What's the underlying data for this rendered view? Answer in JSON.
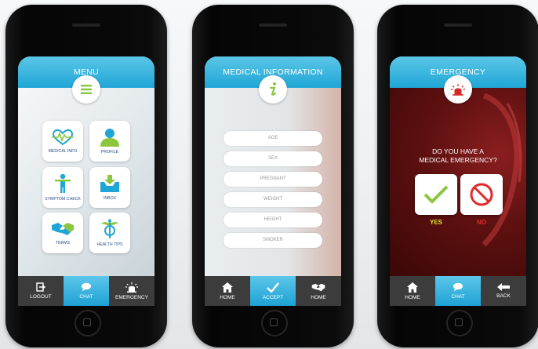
{
  "phones": {
    "menu": {
      "title": "MENU",
      "tiles": [
        {
          "label": "MEDICAL INFO",
          "icon": "heart-pulse-icon"
        },
        {
          "label": "PROFILE",
          "icon": "person-icon"
        },
        {
          "label": "SYMPTOM CHECK",
          "icon": "body-check-icon"
        },
        {
          "label": "INBOX",
          "icon": "inbox-icon"
        },
        {
          "label": "TERMS",
          "icon": "handshake-icon"
        },
        {
          "label": "HEALTH TIPS",
          "icon": "caduceus-icon"
        }
      ],
      "tabs": [
        {
          "label": "LOGOUT",
          "icon": "logout-icon",
          "active": false
        },
        {
          "label": "CHAT",
          "icon": "chat-icon",
          "active": true
        },
        {
          "label": "EMERGENCY",
          "icon": "siren-icon",
          "active": false
        }
      ]
    },
    "medical": {
      "title": "MEDICAL INFORMATION",
      "fields": [
        {
          "placeholder": "AGE"
        },
        {
          "placeholder": "SEX"
        },
        {
          "placeholder": "PREGNANT"
        },
        {
          "placeholder": "WEIGHT"
        },
        {
          "placeholder": "HEIGHT"
        },
        {
          "placeholder": "SMOKER"
        }
      ],
      "tabs": [
        {
          "label": "HOME",
          "icon": "home-icon",
          "active": false
        },
        {
          "label": "ACCEPT",
          "icon": "check-icon",
          "active": true
        },
        {
          "label": "HOME",
          "icon": "handshake-icon",
          "active": false
        }
      ]
    },
    "emergency": {
      "title": "EMERGENCY",
      "question_line1": "DO YOU HAVE A",
      "question_line2": "MEDICAL EMERGENCY?",
      "yes_label": "YES",
      "no_label": "NO",
      "yes_color": "#d8e62a",
      "no_color": "#e02b2b",
      "tabs": [
        {
          "label": "HOME",
          "icon": "home-icon",
          "active": false
        },
        {
          "label": "CHAT",
          "icon": "chat-icon",
          "active": true
        },
        {
          "label": "BACK",
          "icon": "back-arrow-icon",
          "active": false
        }
      ]
    }
  },
  "colors": {
    "header_blue": "#1fa6d6",
    "tile_text": "#2a4d8a",
    "tab_dark": "#3c3c3c"
  }
}
